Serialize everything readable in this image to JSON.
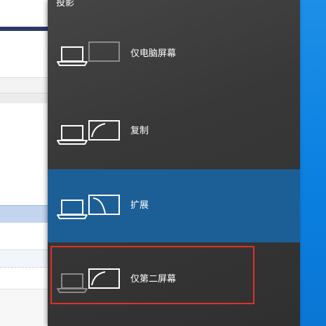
{
  "flyout": {
    "title": "投影",
    "options": [
      {
        "label": "仅电脑屏幕",
        "icon": "pc-screen-only-icon",
        "selected": false
      },
      {
        "label": "复制",
        "icon": "duplicate-icon",
        "selected": false
      },
      {
        "label": "扩展",
        "icon": "extend-icon",
        "selected": true
      },
      {
        "label": "仅第二屏幕",
        "icon": "second-screen-only-icon",
        "selected": false
      }
    ]
  },
  "colors": {
    "flyout_bg": "#3a3a3a",
    "selected_bg": "#1c5f97",
    "highlight_border": "#e0302a",
    "desktop_accent": "#0a7fe0"
  }
}
